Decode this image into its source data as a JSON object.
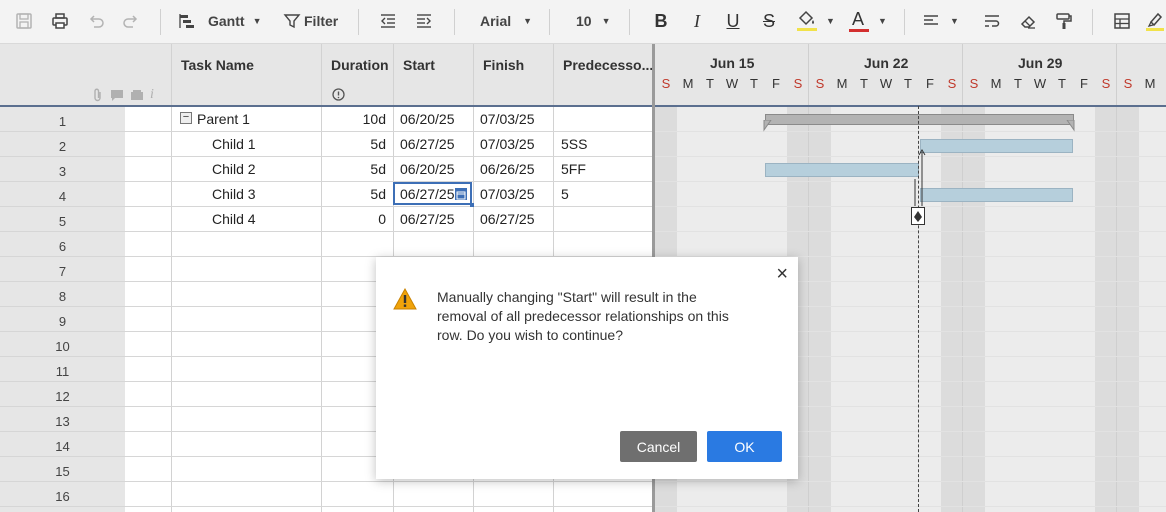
{
  "toolbar": {
    "view_label": "Gantt",
    "filter_label": "Filter",
    "font_family": "Arial",
    "font_size": "10",
    "bold_label": "B",
    "italic_label": "I",
    "underline_label": "U",
    "strike_label": "S",
    "text_color_label": "A"
  },
  "grid": {
    "columns": {
      "task_name": "Task Name",
      "duration": "Duration",
      "start": "Start",
      "finish": "Finish",
      "predecessors": "Predecesso..."
    },
    "rows": [
      {
        "num": "1",
        "name": "Parent 1",
        "duration": "10d",
        "start": "06/20/25",
        "finish": "07/03/25",
        "pred": ""
      },
      {
        "num": "2",
        "name": "Child 1",
        "duration": "5d",
        "start": "06/27/25",
        "finish": "07/03/25",
        "pred": "5SS"
      },
      {
        "num": "3",
        "name": "Child 2",
        "duration": "5d",
        "start": "06/20/25",
        "finish": "06/26/25",
        "pred": "5FF"
      },
      {
        "num": "4",
        "name": "Child 3",
        "duration": "5d",
        "start": "06/27/25",
        "finish": "07/03/25",
        "pred": "5"
      },
      {
        "num": "5",
        "name": "Child 4",
        "duration": "0",
        "start": "06/27/25",
        "finish": "06/27/25",
        "pred": ""
      },
      {
        "num": "6",
        "name": "",
        "duration": "",
        "start": "",
        "finish": "",
        "pred": ""
      },
      {
        "num": "7",
        "name": "",
        "duration": "",
        "start": "",
        "finish": "",
        "pred": ""
      },
      {
        "num": "8",
        "name": "",
        "duration": "",
        "start": "",
        "finish": "",
        "pred": ""
      },
      {
        "num": "9",
        "name": "",
        "duration": "",
        "start": "",
        "finish": "",
        "pred": ""
      },
      {
        "num": "10",
        "name": "",
        "duration": "",
        "start": "",
        "finish": "",
        "pred": ""
      },
      {
        "num": "11",
        "name": "",
        "duration": "",
        "start": "",
        "finish": "",
        "pred": ""
      },
      {
        "num": "12",
        "name": "",
        "duration": "",
        "start": "",
        "finish": "",
        "pred": ""
      },
      {
        "num": "13",
        "name": "",
        "duration": "",
        "start": "",
        "finish": "",
        "pred": ""
      },
      {
        "num": "14",
        "name": "",
        "duration": "",
        "start": "",
        "finish": "",
        "pred": ""
      },
      {
        "num": "15",
        "name": "",
        "duration": "",
        "start": "",
        "finish": "",
        "pred": ""
      },
      {
        "num": "16",
        "name": "",
        "duration": "",
        "start": "",
        "finish": "",
        "pred": ""
      }
    ]
  },
  "gantt": {
    "weeks": [
      "Jun 15",
      "Jun 22",
      "Jun 29"
    ],
    "days": [
      "S",
      "M",
      "T",
      "W",
      "T",
      "F",
      "S",
      "S",
      "M",
      "T",
      "W",
      "T",
      "F",
      "S",
      "S",
      "M",
      "T",
      "W",
      "T",
      "F",
      "S",
      "S",
      "M"
    ]
  },
  "dialog": {
    "message": "Manually changing \"Start\" will result in the removal of all predecessor relationships on this row. Do you wish to continue?",
    "cancel_label": "Cancel",
    "ok_label": "OK",
    "close_label": "×"
  },
  "colors": {
    "accent": "#1a73e8",
    "ok_button": "#2a7ae2",
    "cancel_button": "#6f6f6f",
    "weekend": "#c0392b",
    "task_bar": "#b6cfdc",
    "parent_bar": "#b3b3b3",
    "warning": "#f0a30a"
  }
}
